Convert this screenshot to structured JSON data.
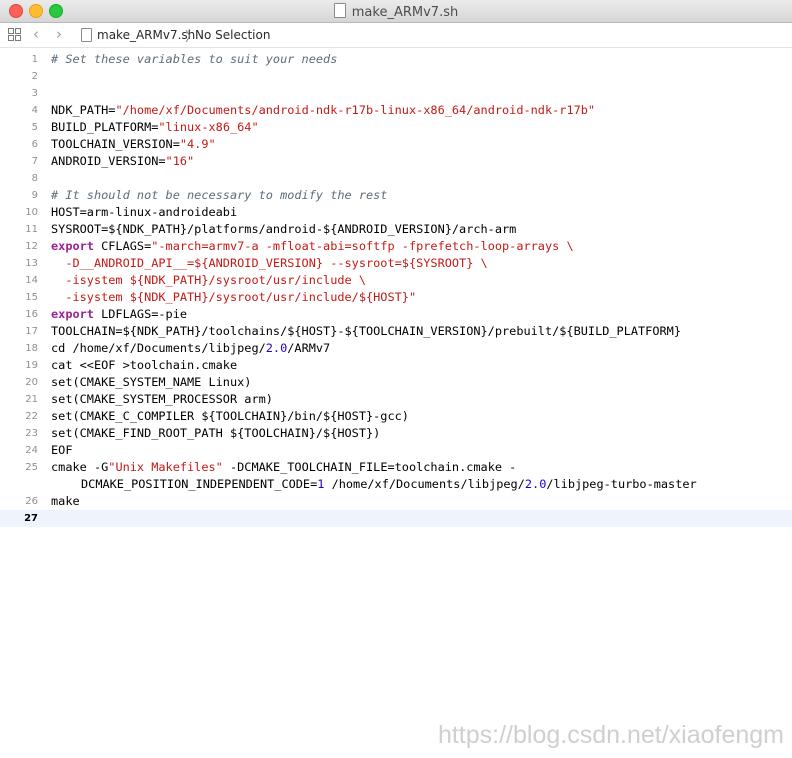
{
  "window": {
    "title": "make_ARMv7.sh"
  },
  "jumpbar": {
    "file": "make_ARMv7.sh",
    "separator": "〉",
    "selection": "No Selection"
  },
  "icons": {
    "back": "chevron-left-icon",
    "forward": "chevron-right-icon",
    "grid": "related-items-grid-icon",
    "file": "document-icon"
  },
  "editor": {
    "current_line": 27,
    "lines": [
      {
        "n": "1",
        "segs": [
          [
            "comment",
            "# Set these variables to suit your needs"
          ]
        ]
      },
      {
        "n": "2",
        "segs": []
      },
      {
        "n": "3",
        "segs": []
      },
      {
        "n": "4",
        "segs": [
          [
            "plain",
            "NDK_PATH="
          ],
          [
            "str",
            "\"/home/xf/Documents/android-ndk-r17b-linux-x86_64/android-ndk-r17b\""
          ]
        ]
      },
      {
        "n": "5",
        "segs": [
          [
            "plain",
            "BUILD_PLATFORM="
          ],
          [
            "str",
            "\"linux-x86_64\""
          ]
        ]
      },
      {
        "n": "6",
        "segs": [
          [
            "plain",
            "TOOLCHAIN_VERSION="
          ],
          [
            "str",
            "\"4.9\""
          ]
        ]
      },
      {
        "n": "7",
        "segs": [
          [
            "plain",
            "ANDROID_VERSION="
          ],
          [
            "str",
            "\"16\""
          ]
        ]
      },
      {
        "n": "8",
        "segs": []
      },
      {
        "n": "9",
        "segs": [
          [
            "comment",
            "# It should not be necessary to modify the rest"
          ]
        ]
      },
      {
        "n": "10",
        "segs": [
          [
            "plain",
            "HOST=arm-linux-androideabi"
          ]
        ]
      },
      {
        "n": "11",
        "segs": [
          [
            "plain",
            "SYSROOT=${NDK_PATH}/platforms/android-${ANDROID_VERSION}/arch-arm"
          ]
        ]
      },
      {
        "n": "12",
        "segs": [
          [
            "kw",
            "export"
          ],
          [
            "plain",
            " CFLAGS="
          ],
          [
            "str",
            "\"-march=armv7-a -mfloat-abi=softfp -fprefetch-loop-arrays \\"
          ]
        ]
      },
      {
        "n": "13",
        "segs": [
          [
            "str",
            "  -D__ANDROID_API__=${ANDROID_VERSION} --sysroot=${SYSROOT} \\"
          ]
        ]
      },
      {
        "n": "14",
        "segs": [
          [
            "str",
            "  -isystem ${NDK_PATH}/sysroot/usr/include \\"
          ]
        ]
      },
      {
        "n": "15",
        "segs": [
          [
            "str",
            "  -isystem ${NDK_PATH}/sysroot/usr/include/${HOST}\""
          ]
        ]
      },
      {
        "n": "16",
        "segs": [
          [
            "kw",
            "export"
          ],
          [
            "plain",
            " LDFLAGS=-pie"
          ]
        ]
      },
      {
        "n": "17",
        "segs": [
          [
            "plain",
            "TOOLCHAIN=${NDK_PATH}/toolchains/${HOST}-${TOOLCHAIN_VERSION}/prebuilt/${BUILD_PLATFORM}"
          ]
        ]
      },
      {
        "n": "18",
        "segs": [
          [
            "plain",
            "cd /home/xf/Documents/libjpeg/"
          ],
          [
            "num",
            "2.0"
          ],
          [
            "plain",
            "/ARMv7"
          ]
        ]
      },
      {
        "n": "19",
        "segs": [
          [
            "plain",
            "cat <<EOF >toolchain.cmake"
          ]
        ]
      },
      {
        "n": "20",
        "segs": [
          [
            "plain",
            "set(CMAKE_SYSTEM_NAME Linux)"
          ]
        ]
      },
      {
        "n": "21",
        "segs": [
          [
            "plain",
            "set(CMAKE_SYSTEM_PROCESSOR arm)"
          ]
        ]
      },
      {
        "n": "22",
        "segs": [
          [
            "plain",
            "set(CMAKE_C_COMPILER ${TOOLCHAIN}/bin/${HOST}-gcc)"
          ]
        ]
      },
      {
        "n": "23",
        "segs": [
          [
            "plain",
            "set(CMAKE_FIND_ROOT_PATH ${TOOLCHAIN}/${HOST})"
          ]
        ]
      },
      {
        "n": "24",
        "segs": [
          [
            "plain",
            "EOF"
          ]
        ]
      },
      {
        "n": "25",
        "segs": [
          [
            "plain",
            "cmake -G"
          ],
          [
            "str",
            "\"Unix Makefiles\""
          ],
          [
            "plain",
            " -DCMAKE_TOOLCHAIN_FILE=toolchain.cmake -"
          ]
        ],
        "wrap": [
          [
            "plain",
            "DCMAKE_POSITION_INDEPENDENT_CODE="
          ],
          [
            "num",
            "1"
          ],
          [
            "plain",
            " /home/xf/Documents/libjpeg/"
          ],
          [
            "num",
            "2.0"
          ],
          [
            "plain",
            "/libjpeg-turbo-master"
          ]
        ]
      },
      {
        "n": "26",
        "segs": [
          [
            "plain",
            "make"
          ]
        ]
      },
      {
        "n": "27",
        "segs": []
      }
    ]
  },
  "watermark": "https://blog.csdn.net/xiaofengm"
}
